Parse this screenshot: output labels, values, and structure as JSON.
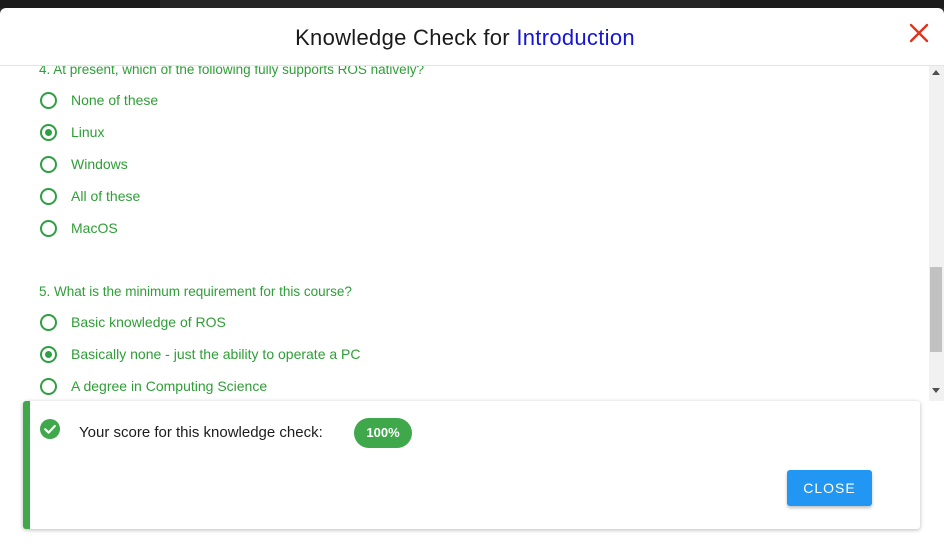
{
  "header": {
    "title_prefix": "Knowledge Check for",
    "title_highlight": "Introduction"
  },
  "questions": [
    {
      "text": "4. At present, which of the following fully supports ROS natively?",
      "options": [
        {
          "label": "None of these",
          "selected": false
        },
        {
          "label": "Linux",
          "selected": true
        },
        {
          "label": "Windows",
          "selected": false
        },
        {
          "label": "All of these",
          "selected": false
        },
        {
          "label": "MacOS",
          "selected": false
        }
      ]
    },
    {
      "text": "5. What is the minimum requirement for this course?",
      "options": [
        {
          "label": "Basic knowledge of ROS",
          "selected": false
        },
        {
          "label": "Basically none - just the ability to operate a PC",
          "selected": true
        },
        {
          "label": "A degree in Computing Science",
          "selected": false
        }
      ]
    }
  ],
  "score": {
    "text": "Your score for this knowledge check:",
    "badge": "100%",
    "close_label": "CLOSE"
  },
  "colors": {
    "accent_green": "#3ea84a",
    "option_green": "#2e9e36",
    "title_blue": "#1414d6",
    "button_blue": "#2196f3",
    "close_red": "#e2341d"
  }
}
